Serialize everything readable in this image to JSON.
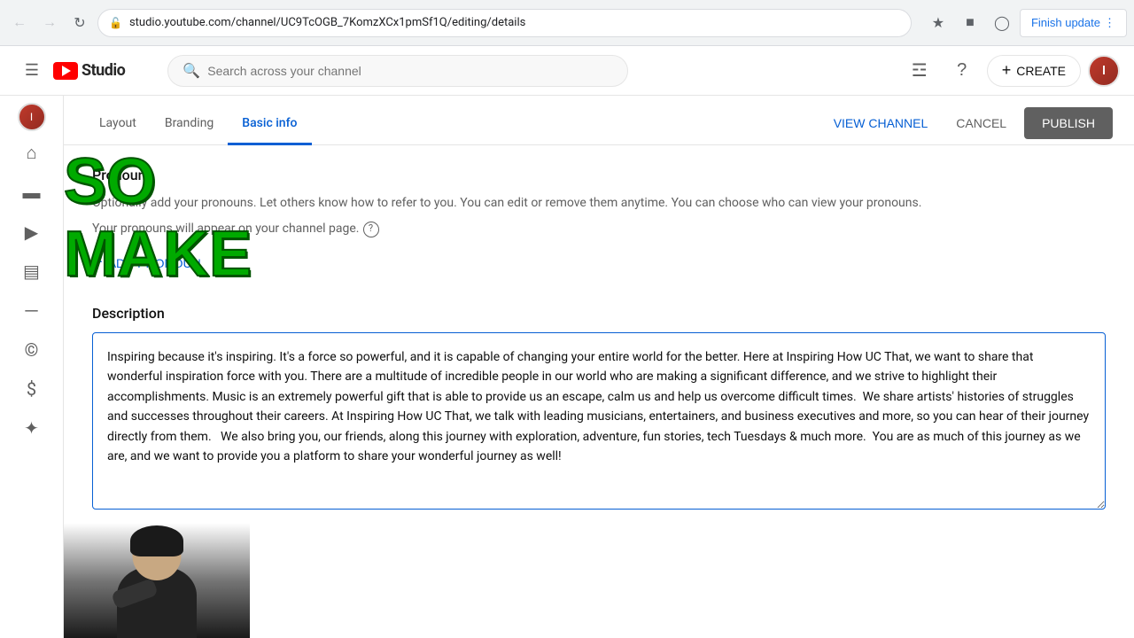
{
  "browser": {
    "url": "studio.youtube.com/channel/UC9TcOGB_7KomzXCx1pmSf1Q/editing/details",
    "finish_update": "Finish update"
  },
  "header": {
    "logo_text": "Studio",
    "search_placeholder": "Search across your channel",
    "create_label": "CREATE"
  },
  "tabs": {
    "layout": "Layout",
    "branding": "Branding",
    "basic_info": "Basic info",
    "view_channel": "VIEW CHANNEL",
    "cancel": "CANCEL",
    "publish": "PUBLISH"
  },
  "pronouns": {
    "title": "Pronouns",
    "description": "Optionally add your pronouns. Let others know how to refer to you. You can edit or remove them anytime. You can choose who can view your pronouns.",
    "line2": "Your pronouns will appear on your channel page.",
    "add_label": "ADD PRONOUN"
  },
  "description": {
    "title": "Description",
    "content": "Inspiring because it's inspiring. It's a force so powerful, and it is capable of changing your entire world for the better. Here at Inspiring How UC That, we want to share that wonderful inspiration force with you. There are a multitude of incredible people in our world who are making a significant difference, and we strive to highlight their accomplishments. Music is an extremely powerful gift that is able to provide us an escape, calm us and help us overcome difficult times.  We share artists' histories of struggles and successes throughout their careers. At Inspiring How UC That, we talk with leading musicians, entertainers, and business executives and more, so you can hear of their journey directly from them.   We also bring you, our friends, along this journey with exploration, adventure, fun stories, tech Tuesdays & much more.  You are as much of this journey as we are, and we want to provide you a platform to share your wonderful journey as well!"
  },
  "overlay": {
    "text": "SO MAKE"
  },
  "sidebar": {
    "items": [
      {
        "icon": "☰",
        "label": ""
      },
      {
        "icon": "⊞",
        "label": ""
      },
      {
        "icon": "▶",
        "label": ""
      },
      {
        "icon": "📊",
        "label": ""
      },
      {
        "icon": "≡",
        "label": ""
      },
      {
        "icon": "©",
        "label": ""
      },
      {
        "icon": "⇄",
        "label": ""
      },
      {
        "icon": "✦",
        "label": ""
      }
    ]
  }
}
